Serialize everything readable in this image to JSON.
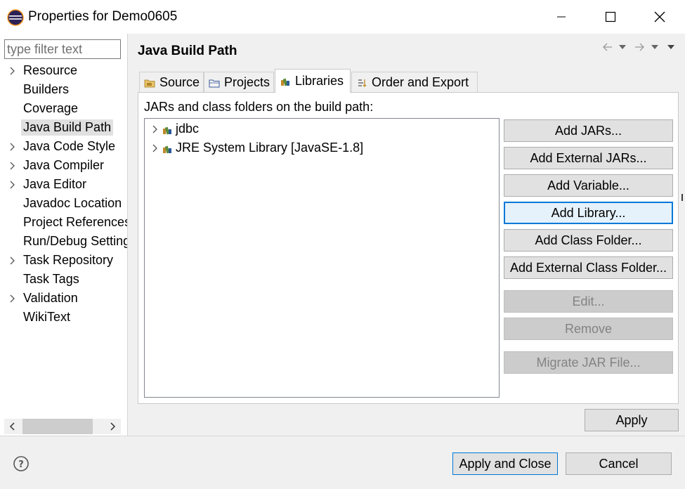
{
  "window": {
    "title": "Properties for Demo0605",
    "minimize_icon": "minimize-icon",
    "maximize_icon": "maximize-icon",
    "close_icon": "close-icon"
  },
  "sidebar": {
    "filter_placeholder": "type filter text",
    "items": [
      {
        "label": "Resource",
        "expandable": true,
        "selected": false
      },
      {
        "label": "Builders",
        "expandable": false,
        "selected": false
      },
      {
        "label": "Coverage",
        "expandable": false,
        "selected": false
      },
      {
        "label": "Java Build Path",
        "expandable": false,
        "selected": true
      },
      {
        "label": "Java Code Style",
        "expandable": true,
        "selected": false
      },
      {
        "label": "Java Compiler",
        "expandable": true,
        "selected": false
      },
      {
        "label": "Java Editor",
        "expandable": true,
        "selected": false
      },
      {
        "label": "Javadoc Location",
        "expandable": false,
        "selected": false
      },
      {
        "label": "Project References",
        "expandable": false,
        "selected": false
      },
      {
        "label": "Run/Debug Settings",
        "expandable": false,
        "selected": false
      },
      {
        "label": "Task Repository",
        "expandable": true,
        "selected": false
      },
      {
        "label": "Task Tags",
        "expandable": false,
        "selected": false
      },
      {
        "label": "Validation",
        "expandable": true,
        "selected": false
      },
      {
        "label": "WikiText",
        "expandable": false,
        "selected": false
      }
    ]
  },
  "page": {
    "title": "Java Build Path"
  },
  "tabs": [
    {
      "label": "Source",
      "icon": "source-folder-icon",
      "active": false
    },
    {
      "label": "Projects",
      "icon": "projects-icon",
      "active": false
    },
    {
      "label": "Libraries",
      "icon": "libraries-icon",
      "active": true
    },
    {
      "label": "Order and Export",
      "icon": "order-export-icon",
      "active": false
    }
  ],
  "libraries": {
    "description": "JARs and class folders on the build path:",
    "items": [
      {
        "label": "jdbc",
        "icon": "library-icon"
      },
      {
        "label": "JRE System Library [JavaSE-1.8]",
        "icon": "library-icon"
      }
    ]
  },
  "buttons": {
    "add_jars": "Add JARs...",
    "add_external_jars": "Add External JARs...",
    "add_variable": "Add Variable...",
    "add_library": "Add Library...",
    "add_class_folder": "Add Class Folder...",
    "add_external_class_folder": "Add External Class Folder...",
    "edit": "Edit...",
    "remove": "Remove",
    "migrate_jar": "Migrate JAR File...",
    "apply": "Apply"
  },
  "footer": {
    "apply_and_close": "Apply and Close",
    "cancel": "Cancel"
  },
  "colors": {
    "accent": "#0078d7",
    "disabled_bg": "#cccccc",
    "selection_bg": "#e0e0e0"
  }
}
